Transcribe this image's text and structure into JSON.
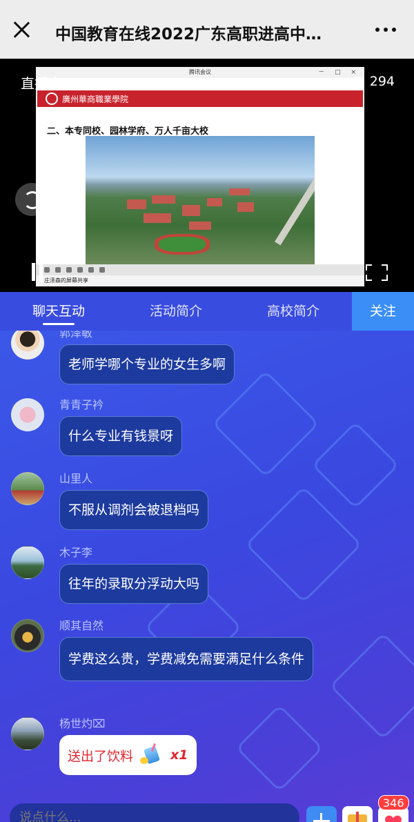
{
  "topbar": {
    "title": "中国教育在线2022广东高职进高中…",
    "close_icon": "close-icon",
    "more_icon": "more-dots-icon"
  },
  "video": {
    "live_label": "直播中",
    "view_count": "294",
    "window_title": "腾讯会议",
    "window_buttons": "－ □ ×",
    "school_name": "廣州華商職業學院",
    "slide_heading": "二、本专同校、园林学府、万人千亩大校",
    "share_status": "庄泽森的屏幕共享"
  },
  "tabs": [
    {
      "label": "聊天互动",
      "active": true
    },
    {
      "label": "活动简介",
      "active": false
    },
    {
      "label": "高校简介",
      "active": false
    }
  ],
  "follow_label": "关注",
  "messages": [
    {
      "name": "郭泽敏",
      "text": "老师学哪个专业的女生多啊"
    },
    {
      "name": "青青子衿",
      "text": "什么专业有钱景呀"
    },
    {
      "name": "山里人",
      "text": "不服从调剂会被退档吗"
    },
    {
      "name": "木子李",
      "text": "往年的录取分浮动大吗"
    },
    {
      "name": "顺其自然",
      "text": "学费这么贵，学费减免需要满足什么条件"
    },
    {
      "name": "杨世灼⌧",
      "gift_text": "送出了饮料",
      "gift_count": "x1"
    }
  ],
  "input": {
    "placeholder": "说点什么..."
  },
  "like_count": "346",
  "colors": {
    "accent": "#3a8ef6",
    "chat_bg": "#3a48e0",
    "gift_red": "#e0262e"
  }
}
